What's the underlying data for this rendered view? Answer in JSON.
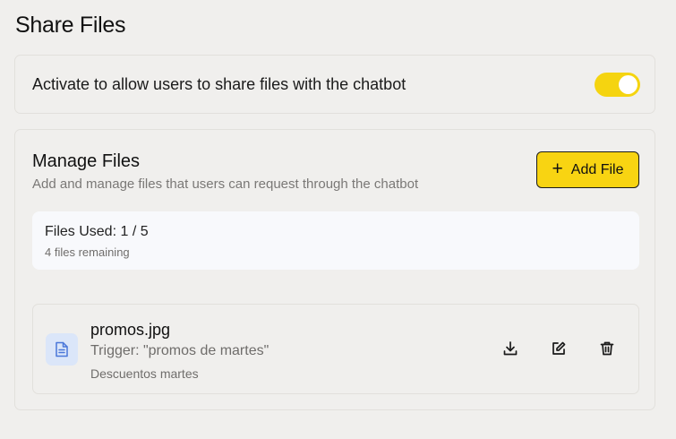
{
  "page": {
    "title": "Share Files"
  },
  "sharing": {
    "toggle_label": "Activate to allow users to share files with the chatbot",
    "enabled": true
  },
  "manage": {
    "title": "Manage Files",
    "subtitle": "Add and manage files that users can request through the chatbot",
    "add_button_label": "Add File",
    "add_button_icon": "plus-icon"
  },
  "usage": {
    "title": "Files Used: 1 / 5",
    "remaining": "4 files remaining",
    "used": 1,
    "limit": 5
  },
  "files": [
    {
      "name": "promos.jpg",
      "trigger": "Trigger: \"promos de martes\"",
      "description": "Descuentos martes",
      "icon": "document-icon",
      "actions": [
        "download-icon",
        "edit-icon",
        "trash-icon"
      ]
    }
  ],
  "colors": {
    "accent": "#f8d412",
    "background": "#f0efed",
    "file_icon_bg": "#dbe6f9",
    "file_icon_fg": "#4a77d9"
  }
}
